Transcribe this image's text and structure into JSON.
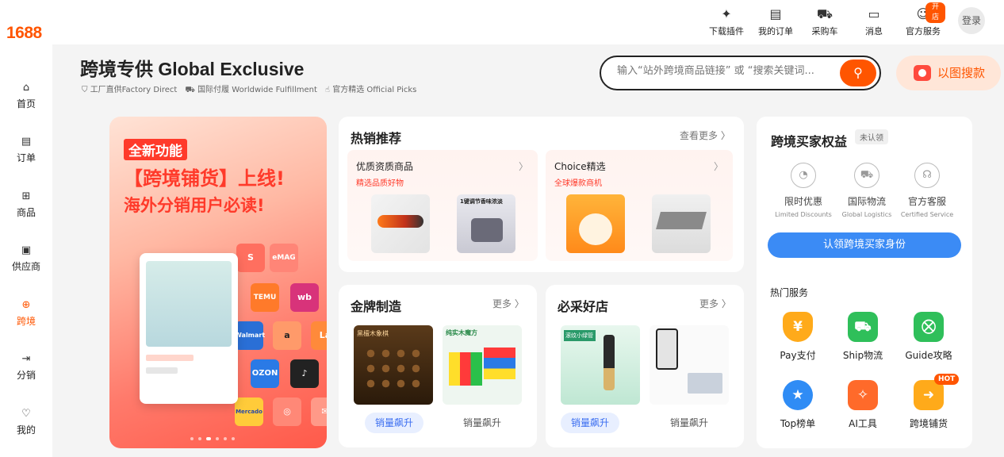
{
  "sidebar": {
    "logo": "1688",
    "items": [
      {
        "label": "首页",
        "icon": "home-icon",
        "glyph": "⌂",
        "active": false
      },
      {
        "label": "订单",
        "icon": "clipboard-icon",
        "glyph": "▤",
        "active": false
      },
      {
        "label": "商品",
        "icon": "grid-icon",
        "glyph": "⊞",
        "active": false
      },
      {
        "label": "供应商",
        "icon": "store-icon",
        "glyph": "▣",
        "active": false
      },
      {
        "label": "跨境",
        "icon": "globe-icon",
        "glyph": "⊕",
        "active": true
      },
      {
        "label": "分销",
        "icon": "share-icon",
        "glyph": "⇥",
        "active": false
      },
      {
        "label": "我的",
        "icon": "profile-icon",
        "glyph": "♡",
        "active": false
      }
    ]
  },
  "topbar": {
    "items": [
      {
        "label": "下载插件",
        "icon": "puzzle-icon",
        "glyph": "✦"
      },
      {
        "label": "我的订单",
        "icon": "order-icon",
        "glyph": "▤"
      },
      {
        "label": "采购车",
        "icon": "cart-icon",
        "glyph": "⛟"
      },
      {
        "label": "消息",
        "icon": "message-icon",
        "glyph": "▭"
      },
      {
        "label": "官方服务",
        "icon": "service-icon",
        "glyph": "☺"
      }
    ],
    "badge": "开店",
    "login": "登录"
  },
  "header": {
    "title": "跨境专供 Global Exclusive",
    "tags": [
      "工厂直供Factory Direct",
      "国际付履 Worldwide Fulfillment",
      "官方精选 Official Picks"
    ]
  },
  "search": {
    "placeholder": "输入“站外跨境商品链接” 或 “搜索关键词...",
    "image_search_label": "以图搜款"
  },
  "banner": {
    "tag": "全新功能",
    "line1": "【跨境铺货】上线!",
    "line2": "海外分销用户必读!",
    "tiles": [
      "S",
      "eMAG",
      "TEMU",
      "wb",
      "Walmart",
      "a",
      "La",
      "OZON",
      "♪",
      "Mercado",
      "◎",
      "✉"
    ],
    "dots": 6,
    "active_dot": 2
  },
  "hot": {
    "title": "热销推荐",
    "more": "查看更多",
    "subs": [
      {
        "title": "优质资质商品",
        "desc": "精选品质好物"
      },
      {
        "title": "Choice精选",
        "desc": "全球爆款商机"
      }
    ]
  },
  "gold": {
    "title": "金牌制造",
    "more": "更多",
    "pills": [
      "销量飙升",
      "销量飙升"
    ],
    "thumb_labels": [
      "黑檀木象棋",
      "纯实木魔方"
    ]
  },
  "shops": {
    "title": "必采好店",
    "more": "更多",
    "pills": [
      "销量飙升",
      "销量飙升"
    ],
    "thumb_labels": [
      "滚纹小绿管"
    ]
  },
  "rights": {
    "title": "跨境买家权益",
    "status": "未认领",
    "benefits": [
      {
        "cn": "限时优惠",
        "en": "Limited Discounts",
        "icon": "discount-icon"
      },
      {
        "cn": "国际物流",
        "en": "Global Logistics",
        "icon": "truck-icon"
      },
      {
        "cn": "官方客服",
        "en": "Certified Service",
        "icon": "headset-icon"
      }
    ],
    "claim": "认领跨境买家身份",
    "services_title": "热门服务",
    "services": [
      {
        "label": "Pay支付",
        "icon": "yen-shield-icon",
        "glyph": "¥",
        "color": "#ffaa1a"
      },
      {
        "label": "Ship物流",
        "icon": "ship-truck-icon",
        "glyph": "⛟",
        "color": "#2fbf5a"
      },
      {
        "label": "Guide攻略",
        "icon": "guide-cart-icon",
        "glyph": "⛒",
        "color": "#2fbf5a"
      },
      {
        "label": "Top榜单",
        "icon": "top-badge-icon",
        "glyph": "★",
        "color": "#2f8cf5"
      },
      {
        "label": "AI工具",
        "icon": "ai-puzzle-icon",
        "glyph": "✧",
        "color": "#ff6a2a"
      },
      {
        "label": "跨境铺货",
        "icon": "export-icon",
        "glyph": "➜",
        "color": "#ffaa1a"
      }
    ],
    "hot_badge": "HOT"
  }
}
